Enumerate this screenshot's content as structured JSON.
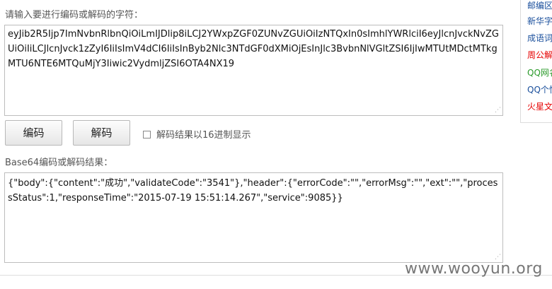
{
  "encoder": {
    "input_label": "请输入要进行编码或解码的字符：",
    "input_value": "eyJib2R5Ijp7ImNvbnRlbnQiOiLmIJDlip8iLCJ2YWxpZGF0ZUNvZGUiOiIzNTQxIn0sImhlYWRlciI6eyJlcnJvckNvZGUiOiIiLCJlcnJvck1zZyI6IiIsImV4dCI6IiIsInByb2Nlc3NTdGF0dXMiOjEsInJlc3BvbnNlVGltZSI6IjIwMTUtMDctMTkgMTU6NTE6MTQuMjY3Iiwic2VydmljZSI6OTA4NX19",
    "encode_button": "编码",
    "decode_button": "解码",
    "hex_checkbox_label": "解码结果以16进制显示",
    "output_label": "Base64编码或解码结果：",
    "output_value": "{\"body\":{\"content\":\"成功\",\"validateCode\":\"3541\"},\"header\":{\"errorCode\":\"\",\"errorMsg\":\"\",\"ext\":\"\",\"processStatus\":1,\"responseTime\":\"2015-07-19 15:51:14.267\",\"service\":9085}}"
  },
  "sidebar": {
    "links": [
      {
        "label": "邮编区",
        "color": "#1a4f9c"
      },
      {
        "label": "新华字",
        "color": "#1a4f9c"
      },
      {
        "label": "成语词",
        "color": "#1a4f9c"
      },
      {
        "label": "周公解",
        "color": "#e60000"
      },
      {
        "label": "QQ网名",
        "color": "#2a9a2a"
      },
      {
        "label": "QQ个性",
        "color": "#1a4f9c"
      },
      {
        "label": "火星文",
        "color": "#e60000"
      }
    ]
  },
  "watermark": "www.wooyun.org"
}
